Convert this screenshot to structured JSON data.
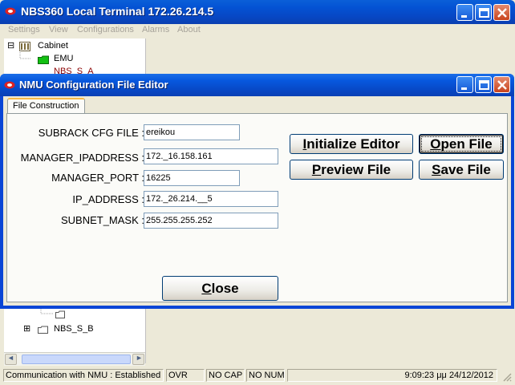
{
  "main_window": {
    "title": "NBS360 Local Terminal 172.26.214.5",
    "menu": [
      "Settings",
      "View",
      "Configurations",
      "Alarms",
      "About"
    ]
  },
  "tree": {
    "nodes": [
      {
        "label": "Cabinet",
        "expander": "⊟"
      },
      {
        "label": "EMU"
      },
      {
        "label": "NBS_S_A"
      },
      {
        "label": "NBS_S_B",
        "expander": "⊞"
      }
    ],
    "scroll_left": "◄",
    "scroll_right": "►"
  },
  "statusbar": {
    "connection": "Communication with NMU : Established",
    "ovr": "OVR",
    "caps": "NO CAP",
    "num": "NO NUM",
    "datetime": "9:09:23 μμ 24/12/2012"
  },
  "dialog": {
    "title": "NMU Configuration File Editor",
    "tab_label": "File Construction",
    "fields": {
      "subrack_cfg_file": {
        "label": "SUBRACK CFG FILE :",
        "value": "ereikou"
      },
      "manager_ipaddress": {
        "label": "MANAGER_IPADDRESS :",
        "value": "172._16.158.161"
      },
      "manager_port": {
        "label": "MANAGER_PORT :",
        "value": "16225"
      },
      "ip_address": {
        "label": "IP_ADDRESS :",
        "value": "172._26.214.__5"
      },
      "subnet_mask": {
        "label": "SUBNET_MASK :",
        "value": "255.255.255.252"
      }
    },
    "buttons": {
      "initialize": {
        "first": "I",
        "rest": "nitialize Editor"
      },
      "open": {
        "first": "O",
        "rest": "pen File"
      },
      "preview": {
        "first": "P",
        "rest": "review File"
      },
      "save": {
        "first": "S",
        "rest": "ave File"
      },
      "close": {
        "first": "C",
        "rest": "lose"
      }
    }
  },
  "colors": {
    "titlebar_blue": "#0747c4",
    "window_face": "#ece9d8",
    "close_red": "#c8431d"
  }
}
